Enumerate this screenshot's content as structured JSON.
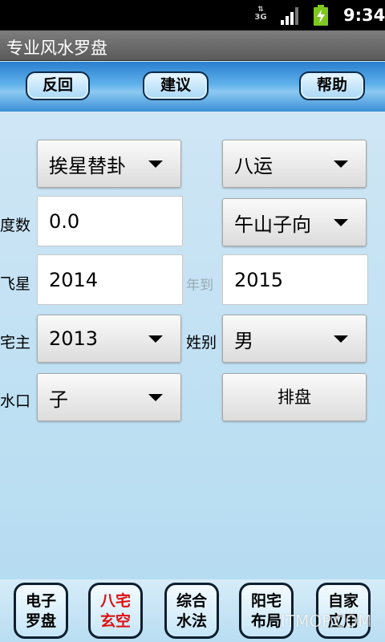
{
  "status": {
    "network": "3G",
    "time": "9:34"
  },
  "app": {
    "title": "专业风水罗盘"
  },
  "toolbar": {
    "back": "反回",
    "suggest": "建议",
    "help": "帮助"
  },
  "form": {
    "method": "挨星替卦",
    "period": "八运",
    "degree_label": "度数",
    "degree_value": "0.0",
    "direction": "午山子向",
    "flying_star_label": "飞星",
    "year_from": "2014",
    "year_to_label": "年到",
    "year_to": "2015",
    "owner_label": "宅主",
    "owner_year": "2013",
    "gender_label": "姓别",
    "gender": "男",
    "water_label": "水口",
    "water_value": "子",
    "arrange_button": "排盘"
  },
  "bottom_nav": [
    {
      "line1": "电子",
      "line2": "罗盘"
    },
    {
      "line1": "八宅",
      "line2": "玄空"
    },
    {
      "line1": "综合",
      "line2": "水法"
    },
    {
      "line1": "阳宅",
      "line2": "布局"
    },
    {
      "line1": "自家",
      "line2": "应用"
    }
  ],
  "watermark": "ITMOP.COM",
  "colors": {
    "active_nav": "#e01010",
    "toolbar_blue": "#2a7fcf"
  }
}
